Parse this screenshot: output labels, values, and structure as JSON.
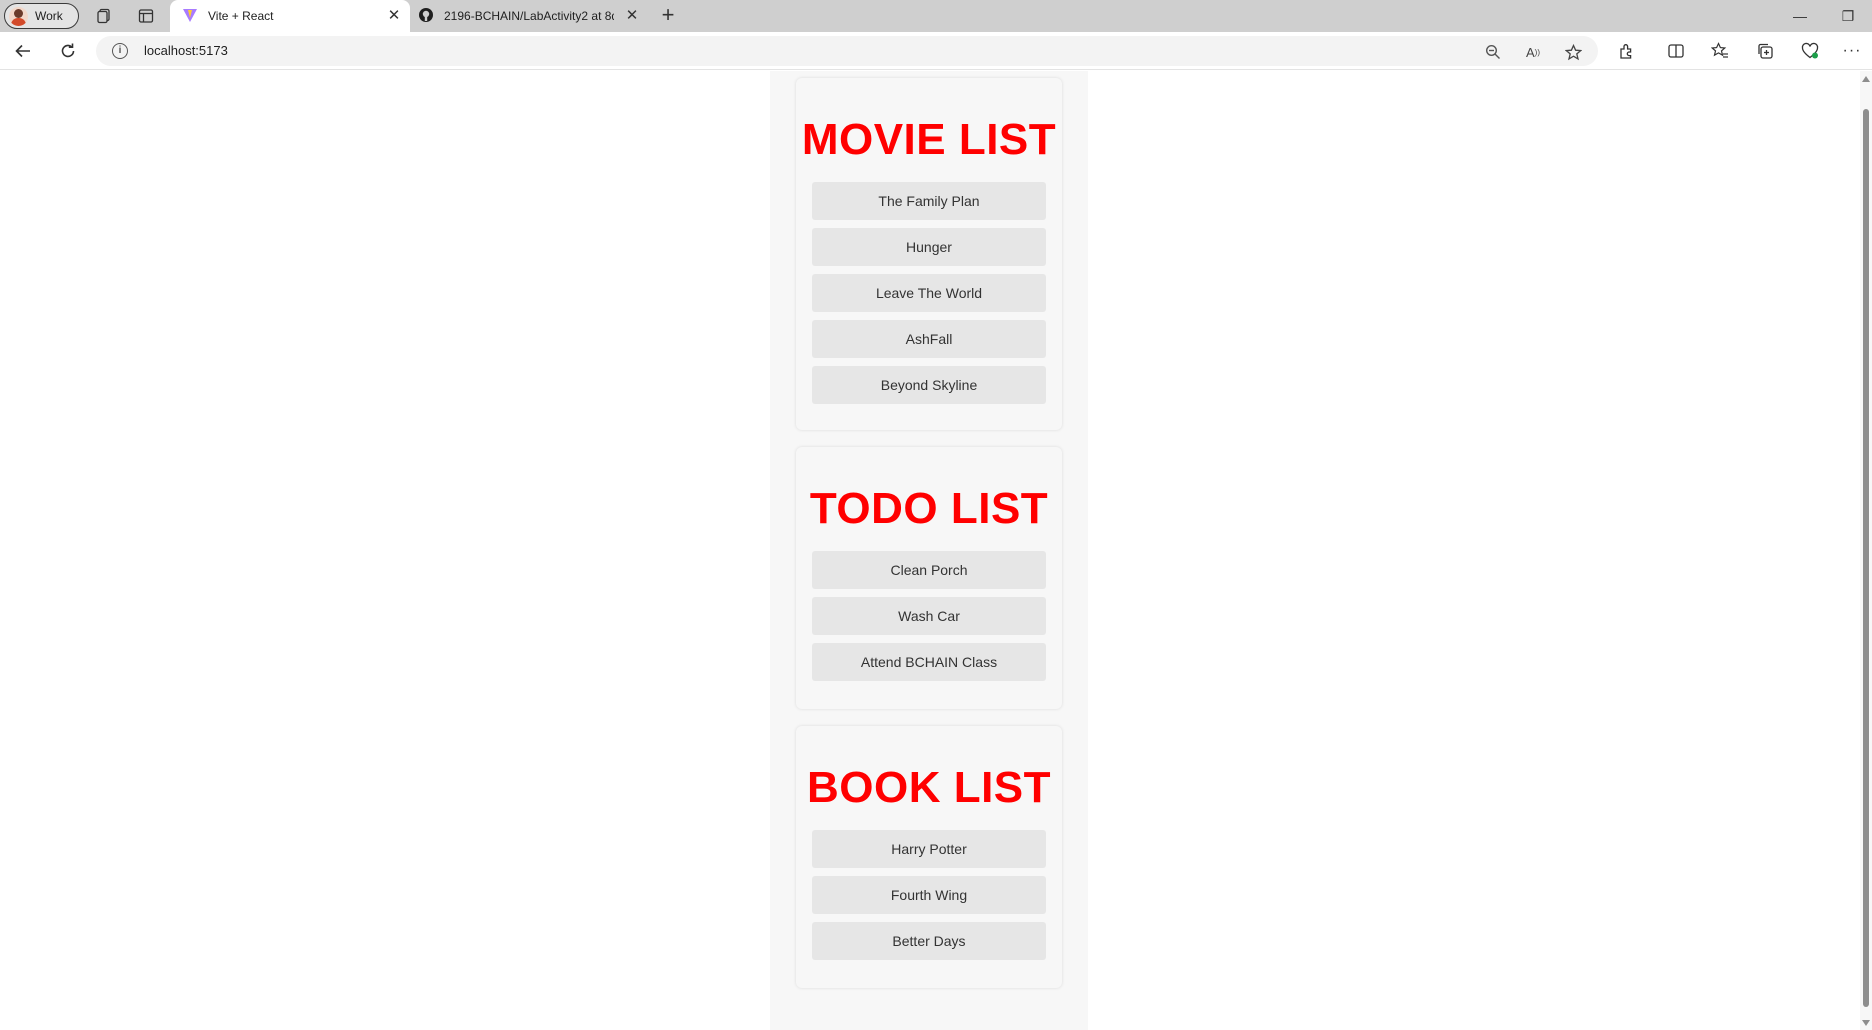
{
  "browser": {
    "profile_label": "Work",
    "tabs": [
      {
        "title": "Vite + React",
        "icon": "vite-icon",
        "active": true
      },
      {
        "title": "2196-BCHAIN/LabActivity2 at 8d",
        "icon": "github-icon",
        "active": false
      }
    ],
    "url": "localhost:5173"
  },
  "sections": [
    {
      "heading": "MOVIE LIST",
      "items": [
        "The Family Plan",
        "Hunger",
        "Leave The World",
        "AshFall",
        "Beyond Skyline"
      ]
    },
    {
      "heading": "TODO LIST",
      "items": [
        "Clean Porch",
        "Wash Car",
        "Attend BCHAIN Class"
      ]
    },
    {
      "heading": "BOOK LIST",
      "items": [
        "Harry Potter",
        "Fourth Wing",
        "Better Days"
      ]
    }
  ],
  "colors": {
    "heading": "#ff0000",
    "item_bg": "#e6e6e6",
    "card_bg": "#f7f7f7"
  }
}
